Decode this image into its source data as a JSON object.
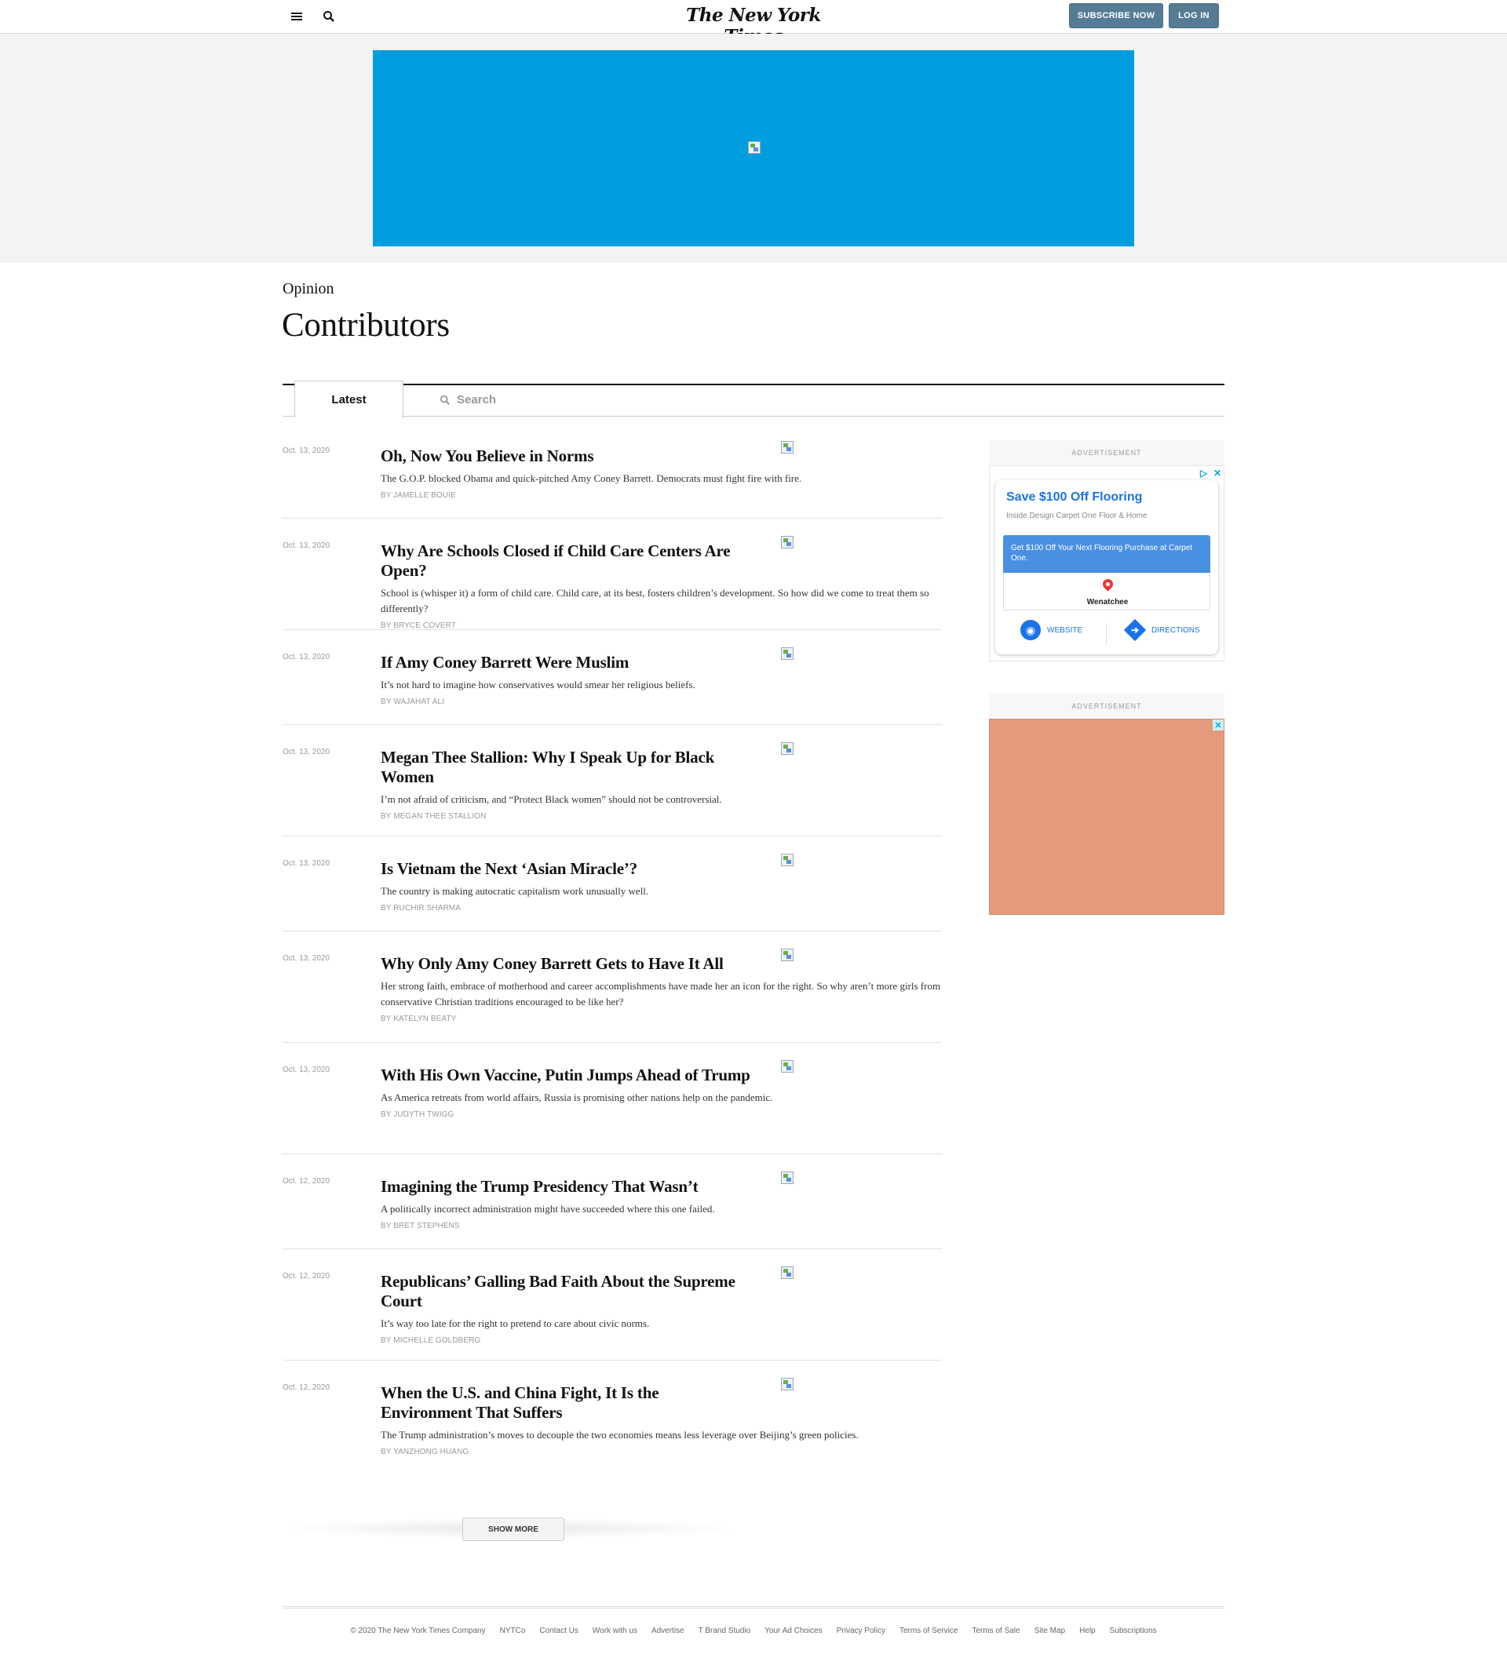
{
  "header": {
    "logo": "The New York Times",
    "subscribe_label": "SUBSCRIBE NOW",
    "login_label": "LOG IN"
  },
  "page": {
    "kicker": "Opinion",
    "title": "Contributors"
  },
  "tabs": {
    "latest_label": "Latest",
    "search_label": "Search"
  },
  "stories": [
    {
      "date": "Oct. 13, 2020",
      "title": "Oh, Now You Believe in Norms",
      "summary": "The G.O.P. blocked Obama and quick-pitched Amy Coney Barrett. Democrats must fight fire with fire.",
      "byline": "By JAMELLE BOUIE"
    },
    {
      "date": "Oct. 13, 2020",
      "title": "Why Are Schools Closed if Child Care Centers Are Open?",
      "summary": "School is (whisper it) a form of child care. Child care, at its best, fosters children’s development. So how did we come to treat them so differently?",
      "byline": "By BRYCE COVERT"
    },
    {
      "date": "Oct. 13, 2020",
      "title": "If Amy Coney Barrett Were Muslim",
      "summary": "It’s not hard to imagine how conservatives would smear her religious beliefs.",
      "byline": "By WAJAHAT ALI"
    },
    {
      "date": "Oct. 13, 2020",
      "title": "Megan Thee Stallion: Why I Speak Up for Black Women",
      "summary": "I’m not afraid of criticism, and “Protect Black women” should not be controversial.",
      "byline": "By MEGAN THEE STALLION"
    },
    {
      "date": "Oct. 13, 2020",
      "title": "Is Vietnam the Next ‘Asian Miracle’?",
      "summary": "The country is making autocratic capitalism work unusually well.",
      "byline": "By RUCHIR SHARMA"
    },
    {
      "date": "Oct. 13, 2020",
      "title": "Why Only Amy Coney Barrett Gets to Have It All",
      "summary": "Her strong faith, embrace of motherhood and career accomplishments have made her an icon for the right. So why aren’t more girls from conservative Christian traditions encouraged to be like her?",
      "byline": "By KATELYN BEATY"
    },
    {
      "date": "Oct. 13, 2020",
      "title": "With His Own Vaccine, Putin Jumps Ahead of Trump",
      "summary": "As America retreats from world affairs, Russia is promising other nations help on the pandemic.",
      "byline": "By JUDYTH TWIGG"
    },
    {
      "date": "Oct. 12, 2020",
      "title": "Imagining the Trump Presidency That Wasn’t",
      "summary": "A politically incorrect administration might have succeeded where this one failed.",
      "byline": "By BRET STEPHENS"
    },
    {
      "date": "Oct. 12, 2020",
      "title": "Republicans’ Galling Bad Faith About the Supreme Court",
      "summary": "It’s way too late for the right to pretend to care about civic norms.",
      "byline": "By MICHELLE GOLDBERG"
    },
    {
      "date": "Oct. 12, 2020",
      "title": "When the U.S. and China Fight, It Is the Environment That Suffers",
      "summary": "The Trump administration’s moves to decouple the two economies means less leverage over Beijing’s green policies.",
      "byline": "By YANZHONG HUANG"
    }
  ],
  "show_more_label": "SHOW MORE",
  "ads": {
    "label": "ADVERTISEMENT",
    "card_title": "Save $100 Off Flooring",
    "card_subtitle": "Inside Design Carpet One Floor & Home",
    "card_offer": "Get $100 Off Your Next Flooring Purchase at Carpet One.",
    "card_location": "Wenatchee",
    "website_label": "WEBSITE",
    "directions_label": "DIRECTIONS",
    "accent_color": "#1a73e8",
    "banner_color": "#009ede",
    "ad2_color": "#e59a7d"
  },
  "footer": {
    "copyright": "© 2020 The New York Times Company",
    "links": [
      "NYTCo",
      "Contact Us",
      "Work with us",
      "Advertise",
      "T Brand Studio",
      "Your Ad Choices",
      "Privacy Policy",
      "Terms of Service",
      "Terms of Sale",
      "Site Map",
      "Help",
      "Subscriptions"
    ]
  }
}
